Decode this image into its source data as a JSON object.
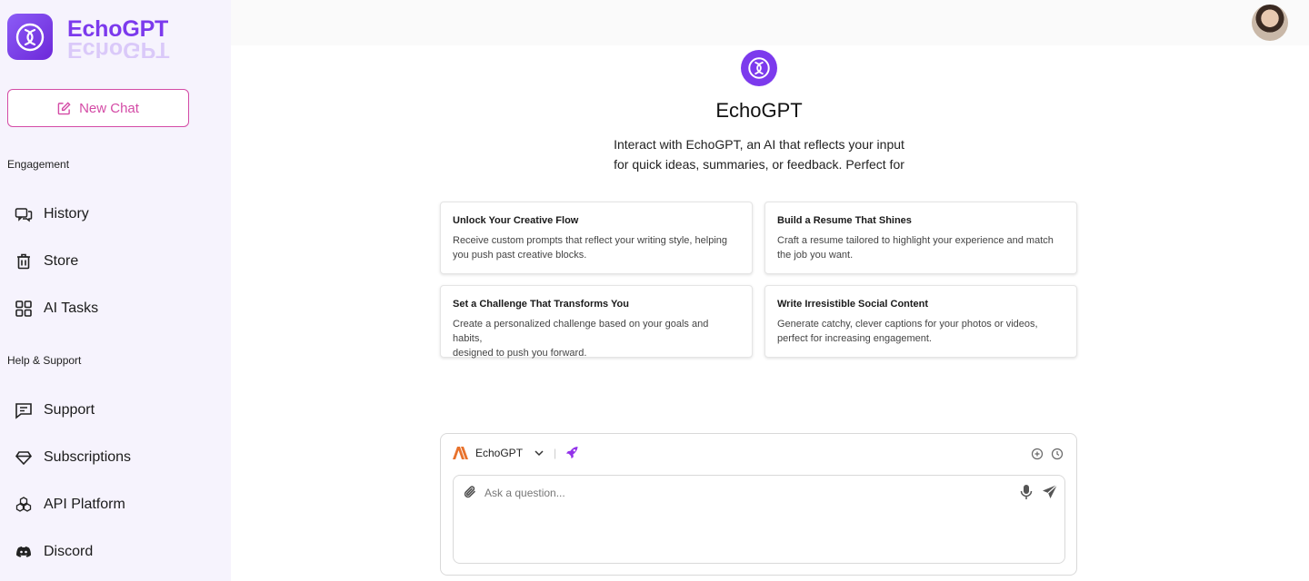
{
  "brand": {
    "name": "EchoGPT"
  },
  "sidebar": {
    "new_chat_label": "New Chat",
    "sections": [
      {
        "label": "Engagement"
      },
      {
        "label": "Help & Support"
      }
    ],
    "items": [
      {
        "label": "History",
        "icon": "history-icon"
      },
      {
        "label": "Store",
        "icon": "trash-icon"
      },
      {
        "label": "AI Tasks",
        "icon": "grid-icon"
      },
      {
        "label": "Support",
        "icon": "message-icon"
      },
      {
        "label": "Subscriptions",
        "icon": "diamond-icon"
      },
      {
        "label": "API Platform",
        "icon": "blocks-icon"
      },
      {
        "label": "Discord",
        "icon": "discord-icon"
      }
    ]
  },
  "hero": {
    "title": "EchoGPT",
    "line1": "Interact with EchoGPT, an AI that reflects your input",
    "line2": "for quick ideas, summaries, or feedback. Perfect for"
  },
  "cards": [
    {
      "title": "Unlock Your Creative Flow",
      "line1": "Receive custom prompts that reflect your writing style, helping",
      "line2": "you push past creative blocks."
    },
    {
      "title": "Build a Resume That Shines",
      "line1": "Craft a resume tailored to highlight your experience and match",
      "line2": "the job you want."
    },
    {
      "title": "Set a Challenge That Transforms You",
      "line1": "Create a personalized challenge based on your goals and habits,",
      "line2": "designed to push you forward."
    },
    {
      "title": "Write Irresistible Social Content",
      "line1": "Generate catchy, clever captions for your photos or videos,",
      "line2": "perfect for increasing engagement."
    }
  ],
  "composer": {
    "model": "EchoGPT",
    "separator": "|",
    "placeholder": "Ask a question...",
    "value": ""
  },
  "colors": {
    "accent": "#7c3aed",
    "new_chat": "#d44ba6",
    "sidebar_bg": "#f6f3fd",
    "model_logo": "#e8722c"
  }
}
